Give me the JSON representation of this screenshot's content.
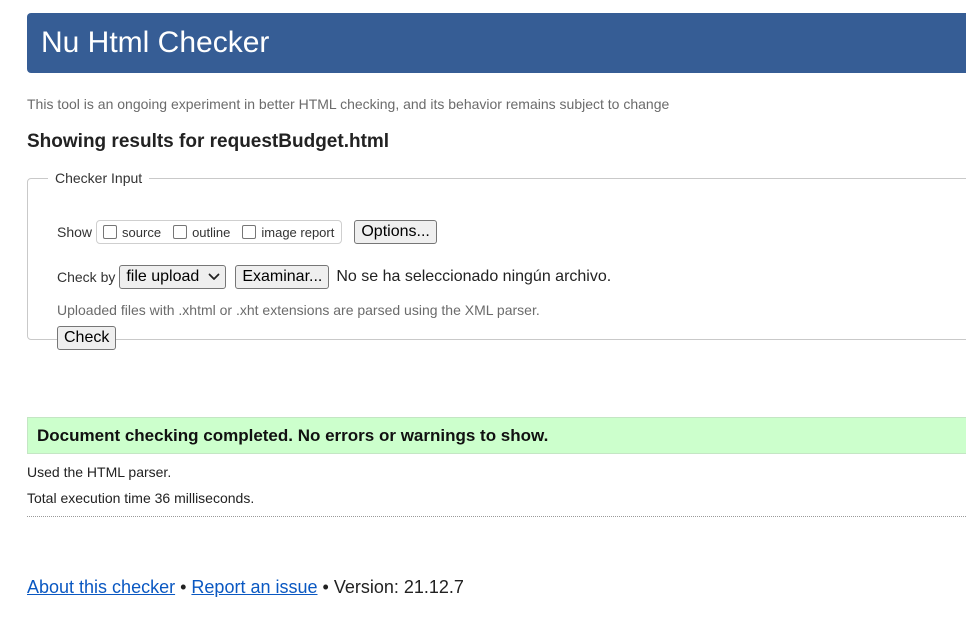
{
  "header": {
    "title": "Nu Html Checker"
  },
  "tagline": "This tool is an ongoing experiment in better HTML checking, and its behavior remains subject to change",
  "results_title": "Showing results for requestBudget.html",
  "checker_input": {
    "legend": "Checker Input",
    "show_label": "Show",
    "show_options": [
      {
        "label": "source",
        "checked": false
      },
      {
        "label": "outline",
        "checked": false
      },
      {
        "label": "image report",
        "checked": false
      }
    ],
    "options_button": "Options...",
    "check_by_label": "Check by",
    "check_by_selected": "file upload",
    "browse_button": "Examinar...",
    "no_file_text": "No se ha seleccionado ningún archivo.",
    "note": "Uploaded files with .xhtml or .xht extensions are parsed using the XML parser.",
    "check_button": "Check"
  },
  "result": {
    "message": "Document checking completed. No errors or warnings to show.",
    "parser_info": "Used the HTML parser.",
    "execution_time": "Total execution time 36 milliseconds."
  },
  "footer": {
    "about_link": "About this checker",
    "separator": "•",
    "report_link": "Report an issue",
    "version": "Version: 21.12.7"
  },
  "colors": {
    "header_bg": "#365d95",
    "success_bg": "#ccffcc",
    "link": "#0a58c2"
  },
  "icons": {
    "select_arrow": "chevron-down-icon"
  }
}
